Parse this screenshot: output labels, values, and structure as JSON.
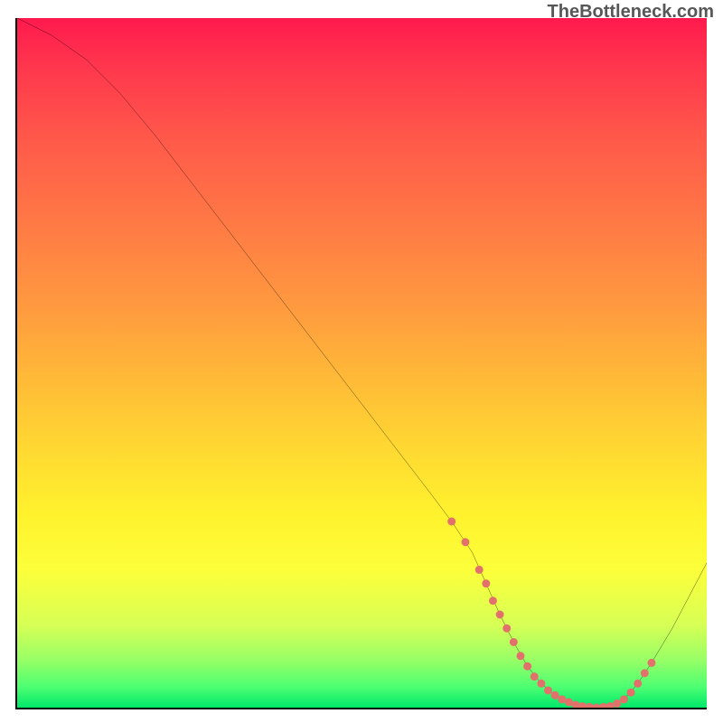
{
  "watermark": "TheBottleneck.com",
  "chart_data": {
    "type": "line",
    "title": "",
    "xlabel": "",
    "ylabel": "",
    "xlim": [
      0,
      100
    ],
    "ylim": [
      0,
      100
    ],
    "x": [
      0,
      5,
      10,
      15,
      20,
      25,
      30,
      35,
      40,
      45,
      50,
      55,
      60,
      63,
      66,
      68,
      70,
      72,
      74,
      76,
      78,
      80,
      82,
      84,
      86,
      88,
      90,
      92,
      95,
      100
    ],
    "y": [
      100,
      97.5,
      94,
      89,
      83,
      76.5,
      70,
      63.5,
      57,
      50.5,
      44,
      37.5,
      31,
      27,
      22.5,
      18,
      13.5,
      9.5,
      6,
      3.5,
      1.8,
      0.8,
      0.2,
      0,
      0.2,
      1.2,
      3.5,
      6.5,
      11.5,
      21
    ],
    "markers": {
      "note": "coral scatter points near the valley",
      "x": [
        63,
        65,
        67,
        68,
        69,
        70,
        71,
        72,
        73,
        74,
        75,
        76,
        77,
        78,
        79,
        80,
        81,
        82,
        83,
        84,
        85,
        86,
        87,
        88,
        89,
        90,
        91,
        92
      ],
      "y": [
        27,
        24,
        20,
        18,
        15.5,
        13.5,
        11.5,
        9.5,
        7.5,
        6,
        4.5,
        3.5,
        2.5,
        1.8,
        1.2,
        0.8,
        0.4,
        0.2,
        0.1,
        0,
        0.1,
        0.2,
        0.6,
        1.2,
        2.2,
        3.5,
        5,
        6.5
      ],
      "color": "#e2716c",
      "size": 9
    },
    "line_color": "#000000",
    "line_width": 2.5
  }
}
